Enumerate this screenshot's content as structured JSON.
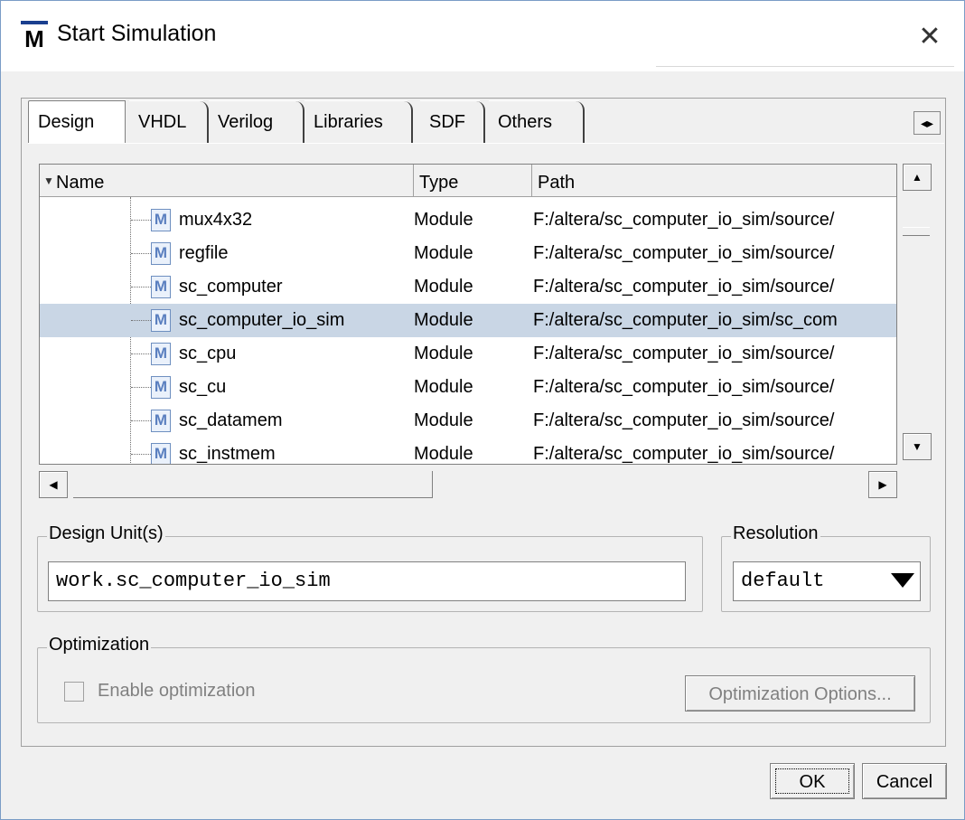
{
  "window": {
    "title": "Start Simulation"
  },
  "tabs": [
    {
      "label": "Design"
    },
    {
      "label": "VHDL"
    },
    {
      "label": "Verilog"
    },
    {
      "label": "Libraries"
    },
    {
      "label": "SDF"
    },
    {
      "label": "Others"
    }
  ],
  "table": {
    "headers": {
      "name": "Name",
      "type": "Type",
      "path": "Path"
    },
    "rows": [
      {
        "name": "mux4x32",
        "type": "Module",
        "path": "F:/altera/sc_computer_io_sim/source/"
      },
      {
        "name": "regfile",
        "type": "Module",
        "path": "F:/altera/sc_computer_io_sim/source/"
      },
      {
        "name": "sc_computer",
        "type": "Module",
        "path": "F:/altera/sc_computer_io_sim/source/"
      },
      {
        "name": "sc_computer_io_sim",
        "type": "Module",
        "path": "F:/altera/sc_computer_io_sim/sc_com"
      },
      {
        "name": "sc_cpu",
        "type": "Module",
        "path": "F:/altera/sc_computer_io_sim/source/"
      },
      {
        "name": "sc_cu",
        "type": "Module",
        "path": "F:/altera/sc_computer_io_sim/source/"
      },
      {
        "name": "sc_datamem",
        "type": "Module",
        "path": "F:/altera/sc_computer_io_sim/source/"
      },
      {
        "name": "sc_instmem",
        "type": "Module",
        "path": "F:/altera/sc_computer_io_sim/source/"
      }
    ],
    "module_icon_letter": "M"
  },
  "design_units": {
    "label": "Design Unit(s)",
    "value": "work.sc_computer_io_sim"
  },
  "resolution": {
    "label": "Resolution",
    "value": "default"
  },
  "optimization": {
    "label": "Optimization",
    "enable_label": "Enable optimization",
    "options_button": "Optimization Options..."
  },
  "buttons": {
    "ok": "OK",
    "cancel": "Cancel"
  },
  "colors": {
    "selected_row": "#c9d6e5",
    "accent": "#1a3f8f"
  },
  "icons": [
    "app-logo-icon",
    "close-icon",
    "tab-scroll-icon",
    "module-icon",
    "sort-arrow-icon",
    "dropdown-arrow-icon"
  ]
}
